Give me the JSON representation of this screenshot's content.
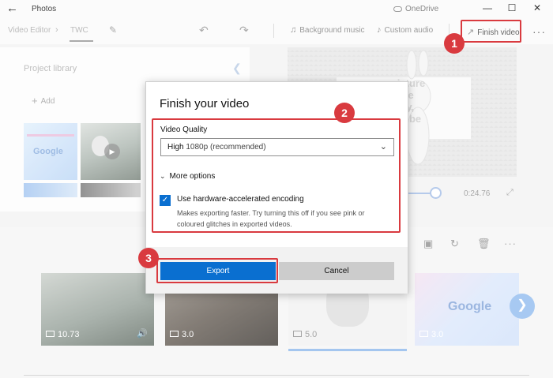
{
  "app": {
    "title": "Photos",
    "onedrive_label": "OneDrive",
    "window_controls": [
      "minimize-icon",
      "maximize-icon",
      "close-icon"
    ]
  },
  "toolbar": {
    "breadcrumb_root": "Video Editor",
    "breadcrumb_current": "TWC",
    "background_music_label": "Background music",
    "custom_audio_label": "Custom audio",
    "finish_video_label": "Finish video"
  },
  "library": {
    "title": "Project library",
    "add_label": "Add"
  },
  "preview": {
    "text_lines": [
      "a picture",
      "fixture",
      "family,",
      "anna be"
    ],
    "time": "0:24.76"
  },
  "storyboard": {
    "clips": [
      {
        "duration": "10.73",
        "type": "video"
      },
      {
        "duration": "3.0",
        "type": "image"
      },
      {
        "duration": "5.0",
        "type": "image"
      },
      {
        "duration": "3.0",
        "type": "image"
      }
    ]
  },
  "dialog": {
    "title": "Finish your video",
    "quality_label": "Video Quality",
    "quality_value": "High",
    "quality_resolution": "1080p (recommended)",
    "more_options_label": "More options",
    "hw_encoding_label": "Use hardware-accelerated encoding",
    "hw_encoding_checked": true,
    "hw_encoding_help": "Makes exporting faster. Try turning this off if you see pink or coloured glitches in exported videos.",
    "export_label": "Export",
    "cancel_label": "Cancel"
  },
  "annotations": {
    "badge_1": "1",
    "badge_2": "2",
    "badge_3": "3"
  },
  "colors": {
    "accent": "#0a6fd0",
    "annotation_red": "#d93a3f"
  }
}
